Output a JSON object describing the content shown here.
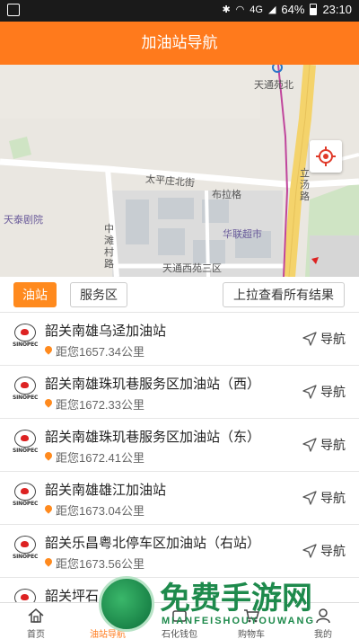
{
  "status_bar": {
    "network": "4G",
    "battery": "64%",
    "time": "23:10"
  },
  "header": {
    "title": "加油站导航"
  },
  "map": {
    "labels": {
      "tiantong_yuanbei": "天通苑北",
      "taipingzhuang_beijie": "太平庄北街",
      "bulage": "布拉格",
      "litang_lu": "立汤路",
      "tiantai_juyuan": "天泰剧院",
      "hualian": "华联超市",
      "zhongtan_cun_lu": "中滩村路",
      "tiantong_xiyuan": "天通西苑三区"
    }
  },
  "filters": {
    "gas_station": "油站",
    "service_area": "服务区",
    "pull_up": "上拉查看所有结果"
  },
  "stations": [
    {
      "name": "韶关南雄乌迳加油站",
      "distance": "距您1657.34公里",
      "nav": "导航"
    },
    {
      "name": "韶关南雄珠玑巷服务区加油站（西）",
      "distance": "距您1672.33公里",
      "nav": "导航"
    },
    {
      "name": "韶关南雄珠玑巷服务区加油站（东）",
      "distance": "距您1672.41公里",
      "nav": "导航"
    },
    {
      "name": "韶关南雄雄江加油站",
      "distance": "距您1673.04公里",
      "nav": "导航"
    },
    {
      "name": "韶关乐昌粤北停车区加油站（右站）",
      "distance": "距您1673.56公里",
      "nav": "导航"
    },
    {
      "name": "韶关坪石…",
      "distance": "",
      "nav": ""
    }
  ],
  "brand_logo_text": "SINOPEC",
  "tabs": [
    {
      "label": "首页"
    },
    {
      "label": "油站导航"
    },
    {
      "label": "石化钱包"
    },
    {
      "label": "购物车"
    },
    {
      "label": "我的"
    }
  ],
  "watermark": {
    "text": "免费手游网",
    "sub": "MIANFEISHOUYOUWANG"
  },
  "colors": {
    "accent": "#ff7a1c",
    "status_bar": "#1a1a1a",
    "map_bg": "#eae7e1",
    "road_yellow": "#f4d36b"
  }
}
